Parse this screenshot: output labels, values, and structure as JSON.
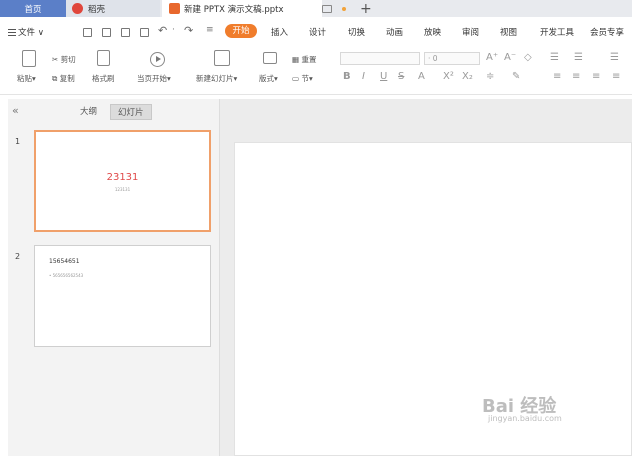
{
  "tabs": {
    "home": "首页",
    "draft": "稻壳",
    "doc": "新建 PPTX 演示文稿.pptx"
  },
  "menu": {
    "file": "文件",
    "start": "开始",
    "items": [
      "插入",
      "设计",
      "切换",
      "动画",
      "放映",
      "审阅",
      "视图",
      "开发工具",
      "会员专享"
    ]
  },
  "ribbon": {
    "paste": "粘贴",
    "cut": "剪切",
    "copy": "复制",
    "format_painter": "格式刷",
    "play_from_current": "当页开始",
    "new_slide": "新建幻灯片",
    "layout": "版式",
    "reset": "重置",
    "section": "节",
    "font_size": "0"
  },
  "panel": {
    "outline_tab": "大纲",
    "slides_tab": "幻灯片"
  },
  "slides": [
    {
      "number": "1",
      "title": "23131",
      "subtitle": "123131"
    },
    {
      "number": "2",
      "title": "15654651",
      "bullet": "• 565656562543"
    }
  ],
  "watermark": {
    "brand": "Bai 经验",
    "url": "jingyan.baidu.com"
  },
  "colors": {
    "home_tab": "#5b7fc8",
    "start_tab": "#f07d2c",
    "selected_thumb_border": "#f0a06a",
    "slide1_title": "#e04a4a"
  }
}
